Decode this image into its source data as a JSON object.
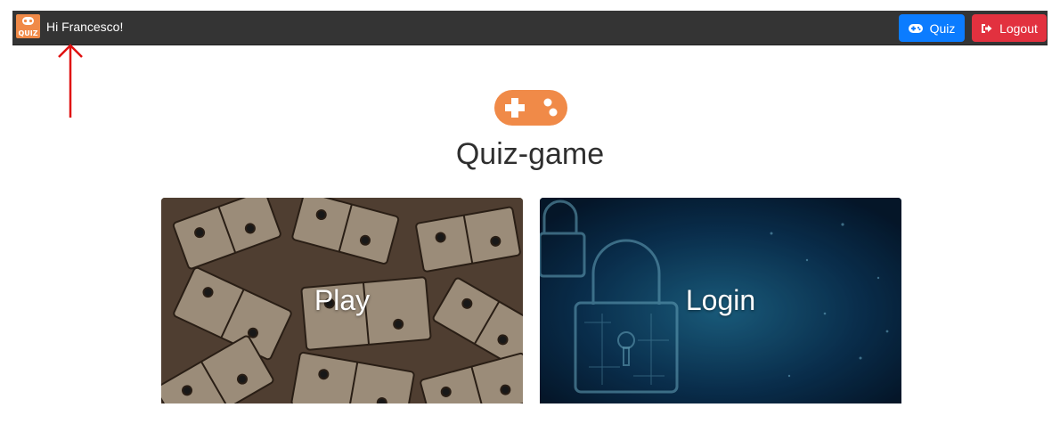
{
  "navbar": {
    "logo_text": "QUIZ",
    "greeting": "Hi Francesco!",
    "quiz_button": {
      "label": "Quiz",
      "icon": "gamepad-icon",
      "color": "#0b7cff"
    },
    "logout_button": {
      "label": "Logout",
      "icon": "sign-out-icon",
      "color": "#e2313f"
    }
  },
  "main": {
    "title": "Quiz-game",
    "hero_icon": "gamepad-icon",
    "accent_color": "#f08a48",
    "cards": [
      {
        "label": "Play",
        "image": "dominoes"
      },
      {
        "label": "Login",
        "image": "digital-padlock"
      }
    ]
  }
}
